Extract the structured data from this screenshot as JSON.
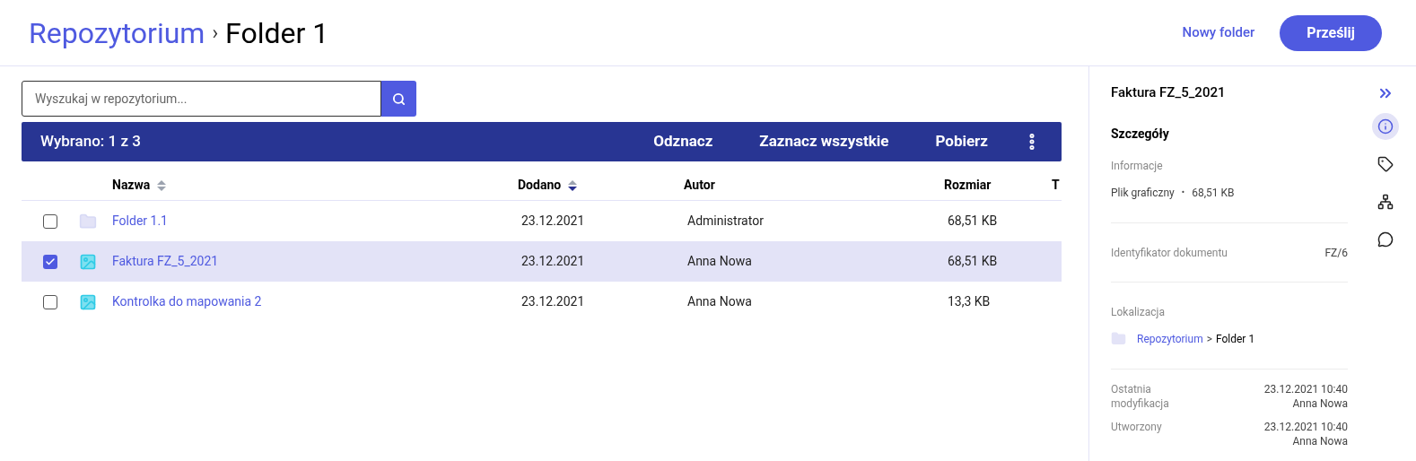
{
  "breadcrumb": {
    "parent": "Repozytorium",
    "separator": "›",
    "current": "Folder 1"
  },
  "actions": {
    "new_folder": "Nowy folder",
    "upload": "Prześlij"
  },
  "search": {
    "placeholder": "Wyszukaj w repozytorium..."
  },
  "selection_bar": {
    "count": "Wybrano: 1 z 3",
    "actions": [
      "Odznacz",
      "Zaznacz wszystkie",
      "Pobierz"
    ]
  },
  "table": {
    "columns": [
      {
        "label": "Nazwa",
        "sorted_desc": false
      },
      {
        "label": "Dodano",
        "sorted_desc": true
      },
      {
        "label": "Autor"
      },
      {
        "label": "Rozmiar"
      },
      {
        "label": "T"
      }
    ],
    "rows": [
      {
        "kind": "folder",
        "name": "Folder 1.1",
        "added": "23.12.2021",
        "author": "Administrator",
        "size": "68,51 KB",
        "selected": false
      },
      {
        "kind": "image",
        "name": "Faktura FZ_5_2021",
        "added": "23.12.2021",
        "author": "Anna Nowa",
        "size": "68,51 KB",
        "selected": true
      },
      {
        "kind": "image",
        "name": "Kontrolka do mapowania 2",
        "added": "23.12.2021",
        "author": "Anna Nowa",
        "size": "13,3 KB",
        "selected": false
      }
    ]
  },
  "details": {
    "title": "Faktura FZ_5_2021",
    "section": "Szczegóły",
    "info_label": "Informacje",
    "file_type": "Plik graficzny",
    "bullet": "•",
    "file_size": "68,51 KB",
    "id_label": "Identyfikator dokumentu",
    "id_value": "FZ/6",
    "location_label": "Lokalizacja",
    "location_parent": "Repozytorium",
    "location_sep": ">",
    "location_current": "Folder 1",
    "dates": [
      {
        "label": "Ostatnia modyfikacja",
        "date": "23.12.2021 10:40",
        "user": "Anna Nowa"
      },
      {
        "label": "Utworzony",
        "date": "23.12.2021 10:40",
        "user": "Anna Nowa"
      }
    ]
  },
  "rail": [
    {
      "kind": "info",
      "selected": true
    },
    {
      "kind": "tag",
      "selected": false
    },
    {
      "kind": "tree",
      "selected": false
    },
    {
      "kind": "comment",
      "selected": false
    }
  ]
}
